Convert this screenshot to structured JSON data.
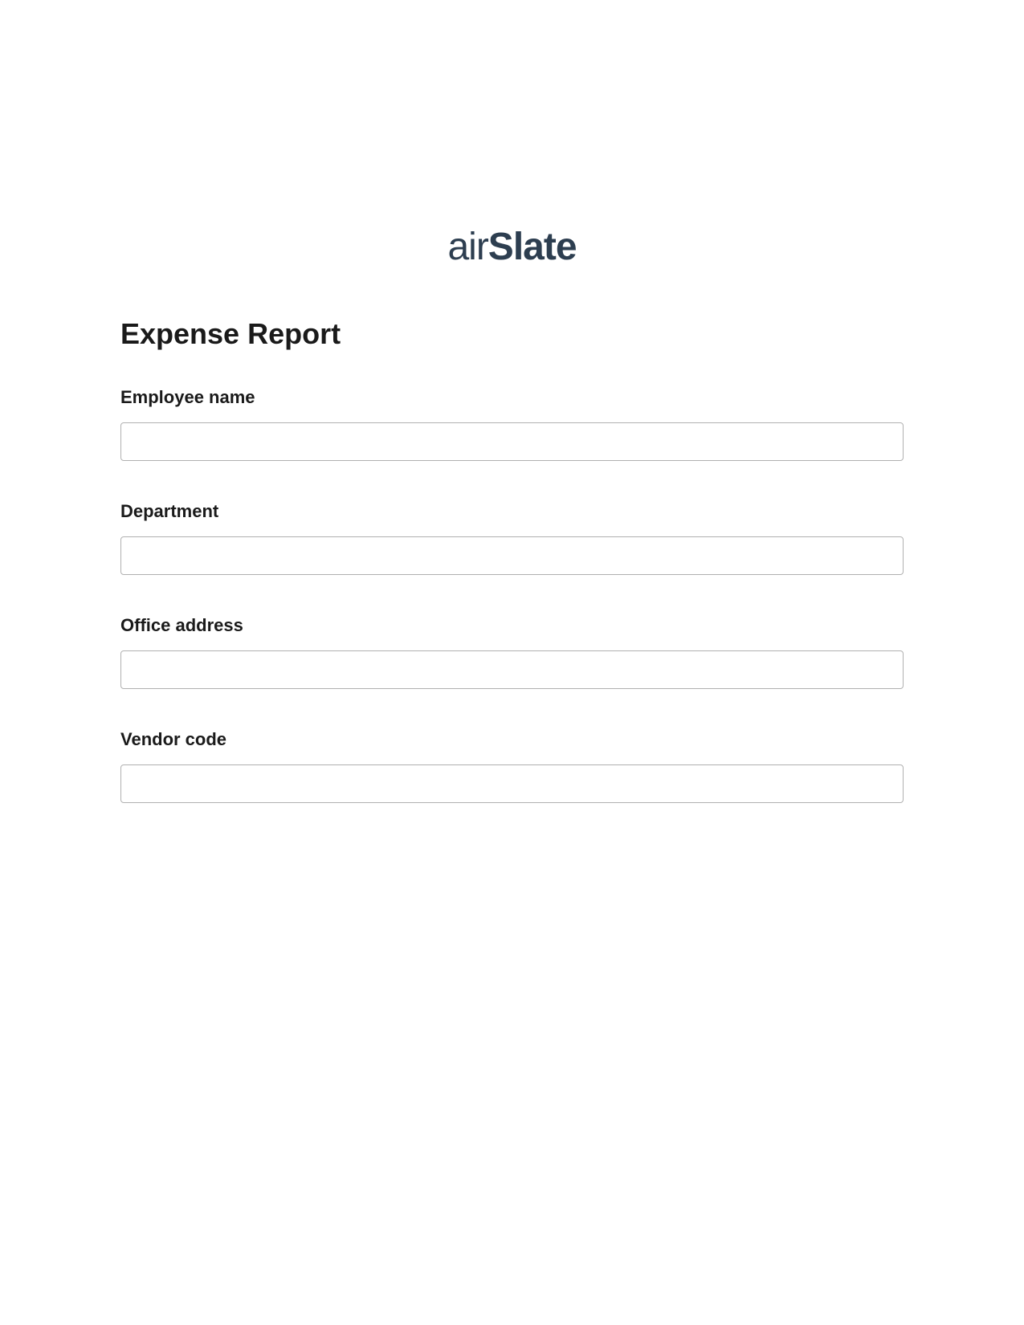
{
  "logo": {
    "prefix": "air",
    "suffix": "Slate"
  },
  "form": {
    "title": "Expense Report",
    "fields": [
      {
        "label": "Employee name",
        "value": ""
      },
      {
        "label": "Department",
        "value": ""
      },
      {
        "label": "Office address",
        "value": ""
      },
      {
        "label": "Vendor code",
        "value": ""
      }
    ]
  }
}
